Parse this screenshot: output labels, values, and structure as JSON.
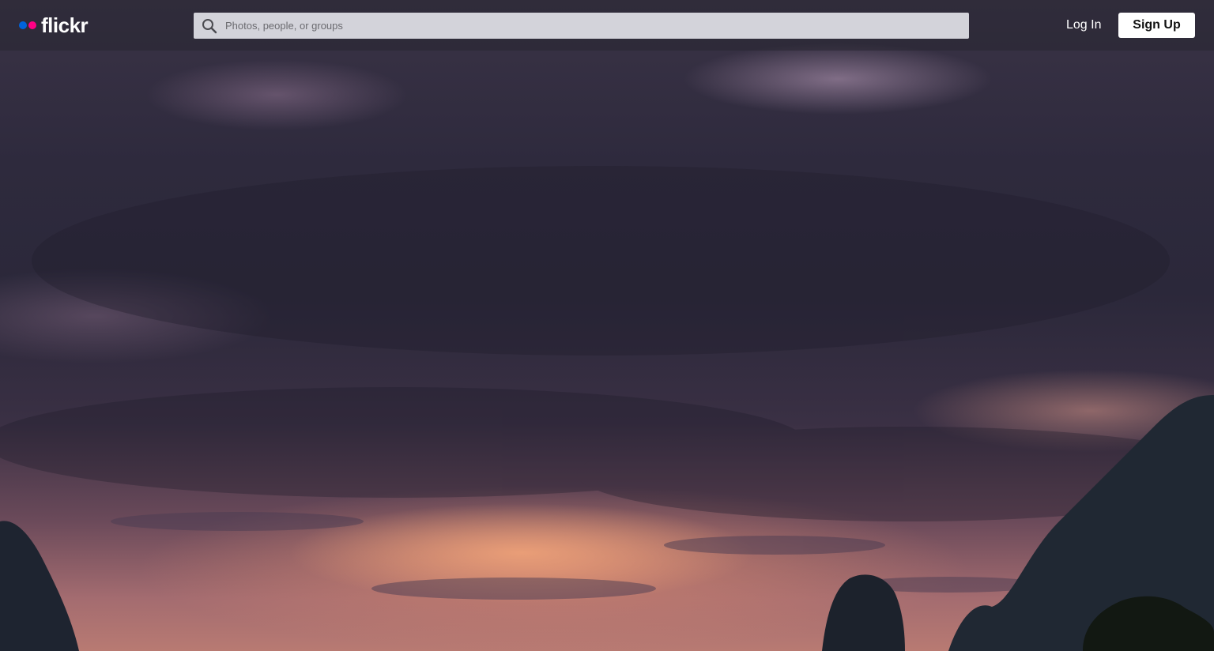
{
  "app": {
    "brand": "flickr",
    "brand_colors": {
      "dot_blue": "#0063dc",
      "dot_pink": "#ff0084"
    }
  },
  "header": {
    "search": {
      "placeholder": "Photos, people, or groups",
      "value": "",
      "icon": "search-icon"
    },
    "login_label": "Log In",
    "signup_label": "Sign Up"
  },
  "hero": {
    "description": "",
    "sky_colors": {
      "cloud_dark": "#2b283a",
      "sunset": "#e8a07a"
    }
  }
}
